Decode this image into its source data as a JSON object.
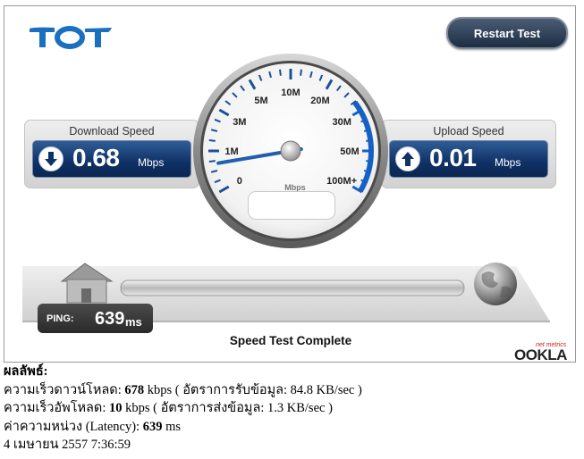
{
  "toolbar": {
    "restart_label": "Restart Test"
  },
  "download": {
    "title": "Download Speed",
    "value": "0.68",
    "unit": "Mbps",
    "icon": "arrow-down-icon"
  },
  "upload": {
    "title": "Upload Speed",
    "value": "0.01",
    "unit": "Mbps",
    "icon": "arrow-up-icon"
  },
  "gauge": {
    "unit": "Mbps",
    "labels": [
      "0",
      "1M",
      "3M",
      "5M",
      "10M",
      "20M",
      "30M",
      "50M",
      "100M+"
    ],
    "needle_mbps": 0.68
  },
  "ping": {
    "label": "PING:",
    "value": "639",
    "unit": "ms"
  },
  "status": "Speed Test Complete",
  "brand": {
    "tot": "TOT",
    "ookla_sup": "net metrics",
    "ookla": "OOKLA"
  },
  "results": {
    "heading": "ผลลัพธ์:",
    "download": {
      "label": "ความเร็วดาวน์โหลด:",
      "value": "678",
      "unit": " kbps ( อัตราการรับข้อมูล: 84.8 KB/sec )"
    },
    "upload": {
      "label": "ความเร็วอัพโหลด:",
      "value": "10",
      "unit": " kbps ( อัตราการส่งข้อมูล: 1.3 KB/sec )"
    },
    "latency": {
      "label": "ค่าความหน่วง (Latency):",
      "value": "639",
      "unit": " ms"
    },
    "timestamp": "4 เมษายน 2557 7:36:59"
  },
  "colors": {
    "accent_blue": "#1560c4",
    "tot_blue": "#1a6fbf",
    "panel_blue": "#0f3166"
  }
}
